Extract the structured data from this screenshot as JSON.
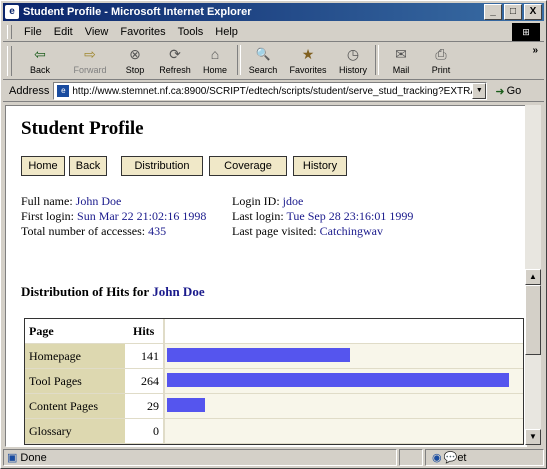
{
  "window": {
    "title": "Student Profile - Microsoft Internet Explorer",
    "buttons": [
      "_",
      "□",
      "X"
    ]
  },
  "menu": [
    "File",
    "Edit",
    "View",
    "Favorites",
    "Tools",
    "Help"
  ],
  "toolbar": [
    {
      "label": "Back",
      "icon": "back-arrow-icon",
      "glyph": "⇦"
    },
    {
      "label": "Forward",
      "icon": "forward-arrow-icon",
      "glyph": "⇨"
    },
    {
      "label": "Stop",
      "icon": "stop-icon",
      "glyph": "⊗"
    },
    {
      "label": "Refresh",
      "icon": "refresh-icon",
      "glyph": "⟳"
    },
    {
      "label": "Home",
      "icon": "home-icon",
      "glyph": "⌂"
    },
    {
      "label": "Search",
      "icon": "search-icon",
      "glyph": "🔍"
    },
    {
      "label": "Favorites",
      "icon": "favorites-icon",
      "glyph": "★"
    },
    {
      "label": "History",
      "icon": "history-icon",
      "glyph": "◷"
    },
    {
      "label": "Mail",
      "icon": "mail-icon",
      "glyph": "✉"
    },
    {
      "label": "Print",
      "icon": "print-icon",
      "glyph": "⎙"
    }
  ],
  "address": {
    "label": "Address",
    "url": "http://www.stemnet.nf.ca:8900/SCRIPT/edtech/scripts/student/serve_stud_tracking?EXTRA_INFO",
    "go": "Go"
  },
  "page": {
    "title": "Student Profile",
    "nav": [
      "Home",
      "Back",
      "Distribution",
      "Coverage",
      "History"
    ],
    "info_left": [
      {
        "label": "Full name:",
        "value": "John Doe"
      },
      {
        "label": "First login:",
        "value": "Sun Mar 22 21:02:16 1998"
      },
      {
        "label": "Total number of accesses:",
        "value": "435"
      }
    ],
    "info_right": [
      {
        "label": "Login ID:",
        "value": "jdoe"
      },
      {
        "label": "Last login:",
        "value": "Tue Sep 28 23:16:01 1999"
      },
      {
        "label": "Last page visited:",
        "value": "Catchingwav"
      }
    ],
    "distribution_title": "Distribution of Hits for",
    "distribution_name": "John Doe"
  },
  "chart_data": {
    "type": "bar",
    "columns": [
      "Page",
      "Hits"
    ],
    "categories": [
      "Homepage",
      "Tool Pages",
      "Content Pages",
      "Glossary"
    ],
    "values": [
      141,
      264,
      29,
      0
    ],
    "max_value": 264,
    "bar_color": "#5555ee"
  },
  "status": {
    "text": "Done",
    "zone": "et"
  }
}
